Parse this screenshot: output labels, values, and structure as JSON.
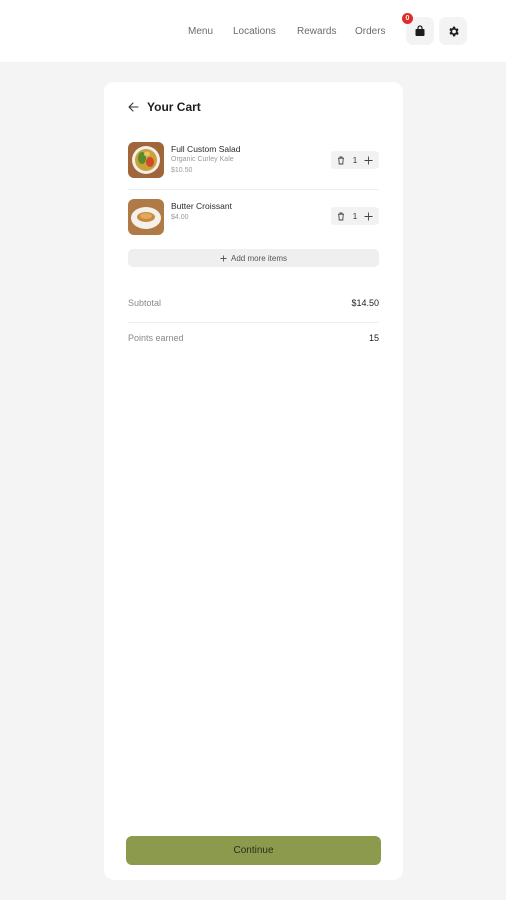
{
  "nav": {
    "links": [
      "Menu",
      "Locations",
      "Rewards",
      "Orders"
    ],
    "cart_badge": "0",
    "cart_icon": "shopping-bag-icon",
    "settings_icon": "gear-icon"
  },
  "cart": {
    "title": "Your Cart",
    "back_icon": "arrow-left-icon",
    "items": [
      {
        "name": "Full Custom Salad",
        "subtitle": "Organic Curley Kale",
        "price": "$10.50",
        "qty": "1",
        "image": "salad-bowl"
      },
      {
        "name": "Butter Croissant",
        "subtitle": "",
        "price": "$4.00",
        "qty": "1",
        "image": "croissant-plate"
      }
    ],
    "add_more_label": "Add more items",
    "subtotal_label": "Subtotal",
    "subtotal_value": "$14.50",
    "points_label": "Points earned",
    "points_value": "15",
    "continue_label": "Continue"
  },
  "colors": {
    "accent": "#8c9a4e",
    "badge": "#e02b2b",
    "background": "#f4f4f4"
  }
}
